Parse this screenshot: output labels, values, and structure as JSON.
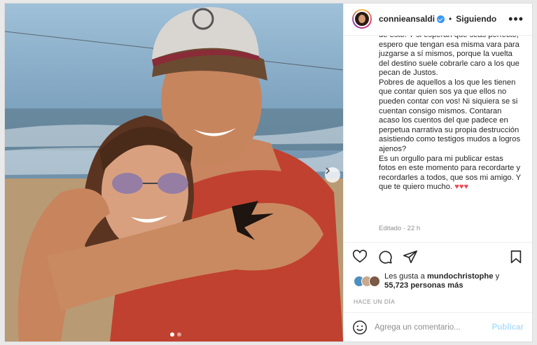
{
  "header": {
    "username": "connieansaldi",
    "separator": "•",
    "follow_label": "Siguiendo",
    "more_label": "•••"
  },
  "caption": {
    "text": "de esto. Y si esperan que seas perfecto, espero que tengan esa misma vara para juzgarse a sí mismos, porque la vuelta del destino suele cobrarle caro a los que pecan de Justos.\nPobres de aquellos a los que les tienen que contar quien sos ya que ellos no pueden contar con vos! Ni siquiera se si cuentan consigo mismos. Contaran acaso los cuentos del que padece en perpetua narrativa su propia destrucción asistiendo como testigos mudos a logros ajenos?\nEs un orgullo para mi publicar estas fotos en este momento para recordarte y recordarles a todos, que sos mi amigo. Y que te quiero mucho.",
    "hearts": "♥♥♥",
    "edited": "Editado · 22 h"
  },
  "likes": {
    "prefix": "Les gusta a",
    "user": "mundochristophe",
    "conj": "y",
    "count": "55,723 personas más"
  },
  "time_label": "HACE UN DÍA",
  "comment": {
    "placeholder": "Agrega un comentario...",
    "publish_label": "Publicar"
  },
  "carousel": {
    "current": 1,
    "total": 2
  },
  "colors": {
    "verified": "#3897f0",
    "heart": "#ed4956",
    "publish_disabled": "#b2dffc"
  }
}
